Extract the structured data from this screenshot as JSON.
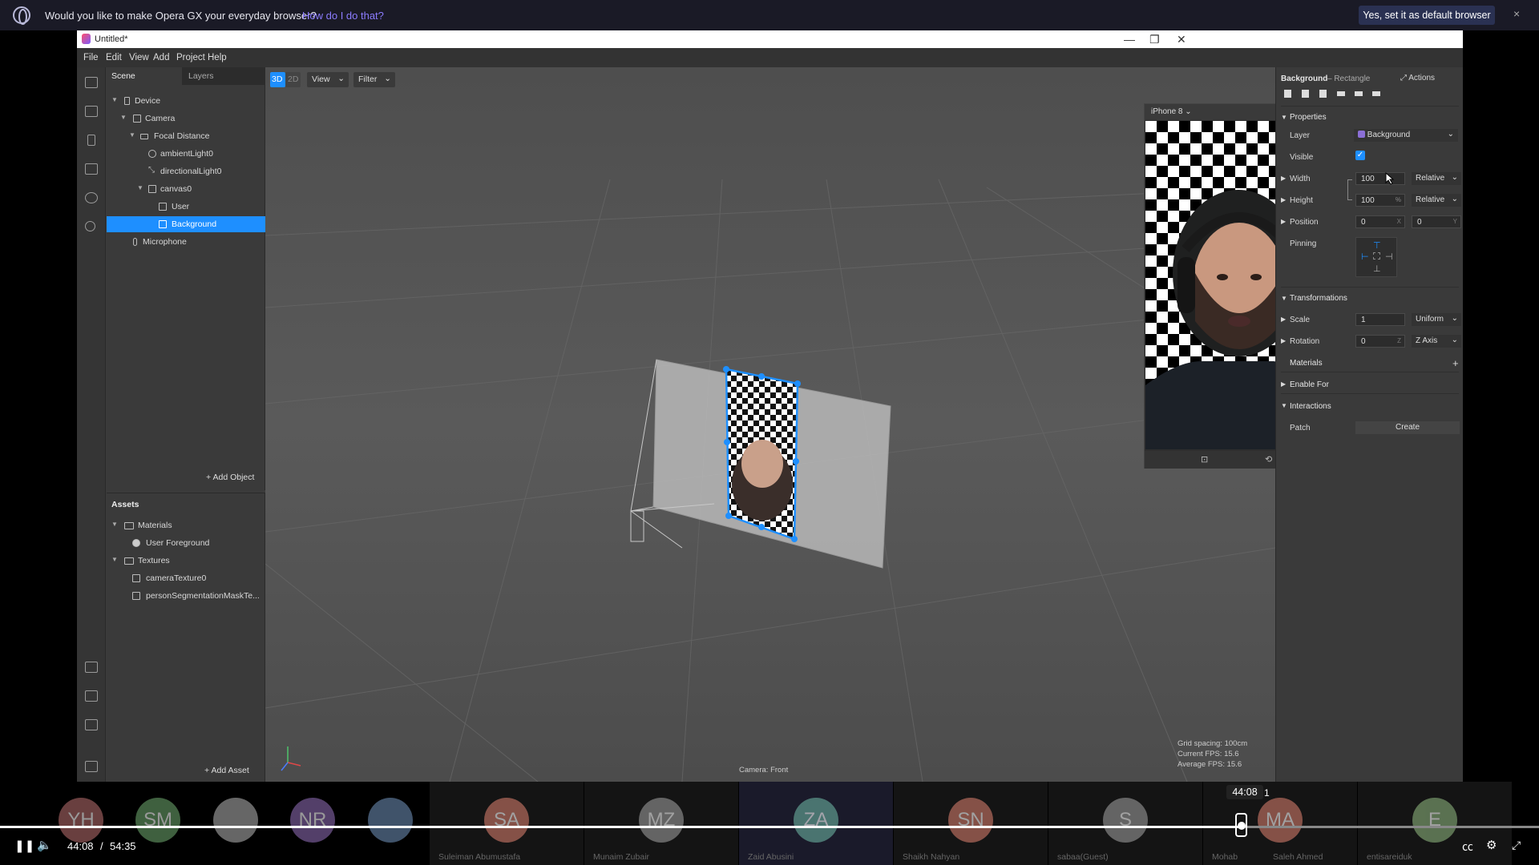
{
  "opera": {
    "question": "Would you like to make Opera GX your everyday browser?",
    "link": "How do I do that?",
    "button": "Yes, set it as default browser",
    "close": "×"
  },
  "window": {
    "title": "Untitled*"
  },
  "menu": [
    "File",
    "Edit",
    "View",
    "Add",
    "Project",
    "Help"
  ],
  "scene_panel": {
    "tab_scene": "Scene",
    "tab_layers": "Layers",
    "tree": [
      {
        "label": "Device"
      },
      {
        "label": "Camera"
      },
      {
        "label": "Focal Distance"
      },
      {
        "label": "ambientLight0"
      },
      {
        "label": "directionalLight0"
      },
      {
        "label": "canvas0"
      },
      {
        "label": "User"
      },
      {
        "label": "Background"
      },
      {
        "label": "Microphone"
      }
    ],
    "add_object": "+ Add Object"
  },
  "assets_panel": {
    "title": "Assets",
    "tree": [
      {
        "label": "Materials"
      },
      {
        "label": "User Foreground"
      },
      {
        "label": "Textures"
      },
      {
        "label": "cameraTexture0"
      },
      {
        "label": "personSegmentationMaskTe..."
      }
    ],
    "add_asset": "+ Add Asset"
  },
  "viewport": {
    "mode_3d": "3D",
    "mode_2d": "2D",
    "view": "View",
    "filter": "Filter",
    "grid_spacing": "Grid spacing: 100cm",
    "current_fps": "Current FPS:  15.6",
    "average_fps": "Average FPS:  15.6",
    "camera_label": "Camera: Front"
  },
  "preview": {
    "device": "iPhone 8"
  },
  "inspector": {
    "title": "Background",
    "subtitle": "– Rectangle",
    "actions": "Actions",
    "properties": "Properties",
    "layer_label": "Layer",
    "layer_value": "Background",
    "visible_label": "Visible",
    "width_label": "Width",
    "width_value": "100",
    "width_mode": "Relative",
    "height_label": "Height",
    "height_value": "100",
    "height_unit": "%",
    "height_mode": "Relative",
    "position_label": "Position",
    "position_x": "0",
    "position_x_axis": "X",
    "position_y": "0",
    "position_y_axis": "Y",
    "pinning_label": "Pinning",
    "transformations": "Transformations",
    "scale_label": "Scale",
    "scale_value": "1",
    "scale_mode": "Uniform",
    "rotation_label": "Rotation",
    "rotation_value": "0",
    "rotation_axis_letter": "Z",
    "rotation_axis": "Z Axis",
    "materials": "Materials",
    "enable_for": "Enable For",
    "interactions": "Interactions",
    "patch_label": "Patch",
    "create": "Create"
  },
  "meeting": {
    "participants": [
      {
        "initials": "YH",
        "name": "",
        "color": "#b06a6a"
      },
      {
        "initials": "SM",
        "name": "",
        "color": "#6aa06a"
      },
      {
        "initials": "",
        "name": "",
        "color": "#aaaaaa"
      },
      {
        "initials": "NR",
        "name": "",
        "color": "#8a6ab0"
      },
      {
        "initials": "",
        "name": "",
        "color": "#6a8ab0"
      },
      {
        "initials": "SA",
        "name": "Suleiman Abumustafa",
        "color": "#d07a6a"
      },
      {
        "initials": "MZ",
        "name": "Munaim Zubair",
        "color": "#9a9a9a"
      },
      {
        "initials": "ZA",
        "name": "Zaid Abusini",
        "color": "#6ab0a0"
      },
      {
        "initials": "SN",
        "name": "Shaikh Nahyan",
        "color": "#d07a6a"
      },
      {
        "initials": "S",
        "name": "sabaa(Guest)",
        "color": "#9a9a9a"
      },
      {
        "initials": "MA",
        "name": "Saleh Ahmed",
        "color": "#d07a6a"
      },
      {
        "initials": "E",
        "name": "entisareiduk",
        "color": "#8ab07a"
      }
    ],
    "mohab_label": "Mohab",
    "progress_fraction": 0.807
  },
  "player": {
    "current": "44:08",
    "separator": "/",
    "total": "54:35",
    "tooltip_time": "44:08",
    "tooltip_extra": "1"
  }
}
